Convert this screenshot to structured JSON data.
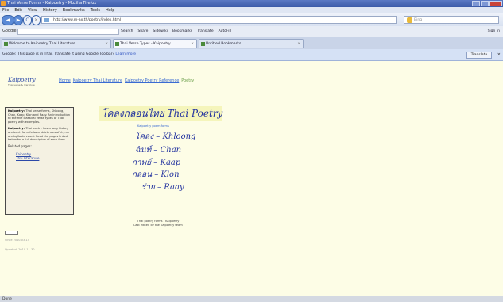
{
  "window": {
    "title": "Thai Verse Forms - Kaipoetry - Mozilla Firefox"
  },
  "menu": [
    "File",
    "Edit",
    "View",
    "History",
    "Bookmarks",
    "Tools",
    "Help"
  ],
  "nav": {
    "back": "◀",
    "forward": "▶",
    "reload": "C",
    "stop": "✕",
    "home": "⌂",
    "url": "http://www.m-ax.th/poetry/index.html",
    "search_placeholder": "Bing"
  },
  "gtoolbar": {
    "label": "Google",
    "items": [
      "Search",
      "Share",
      "Sidewiki",
      "Bookmarks",
      "Translate",
      "AutoFill"
    ],
    "signin": "Sign In"
  },
  "tabs": [
    {
      "label": "Welcome to Kaipoetry Thai Literature"
    },
    {
      "label": "Thai Verse Types - Kaipoetry"
    },
    {
      "label": "Untitled Bookmarks"
    }
  ],
  "translate_bar": {
    "message": "Google: This page is in Thai. Translate it using Google Toolbar?",
    "learn": "Learn more",
    "button": "Translate"
  },
  "page": {
    "logo": "Kaipoetry",
    "logo_sub": "Thai verse & literature",
    "breadcrumbs": [
      "Home",
      "Kaipoetry Thai Literature",
      "Kaipoetry Poetry Reference",
      "Poetry"
    ],
    "left_panel": {
      "p1_head": "Kaipoetry:",
      "p1": "Thai verse forms, Khloong, Chan, Kaap, Klon and Raay. An introduction to the five classical verse types of Thai poetry with examples.",
      "p2_head": "Kaipoetry:",
      "p2": "Thai poetry has a long history and each form follows strict rules of rhyme and syllable count. Read the pages linked below for a full description of each form.",
      "heading": "Related pages:",
      "links": [
        "Kaipoetry",
        "Thai Literature"
      ]
    },
    "meta1": "Since 2010-03-15",
    "meta2": "Updated: 2010-11-30",
    "title": "โคลงกลอนไทย Thai Poetry",
    "subtitle": "Kaipoetry poem forms",
    "forms": [
      {
        "thai": "โคลง",
        "roman": "Khloong"
      },
      {
        "thai": "ฉันท์",
        "roman": "Chan"
      },
      {
        "thai": "กาพย์",
        "roman": "Kaap"
      },
      {
        "thai": "กลอน",
        "roman": "Klon"
      },
      {
        "thai": "ร่าย",
        "roman": "Raay"
      }
    ],
    "footer_line1": "Thai poetry forms - Kaipoetry",
    "footer_line2": "Last edited by the Kaipoetry team"
  },
  "status": "Done"
}
